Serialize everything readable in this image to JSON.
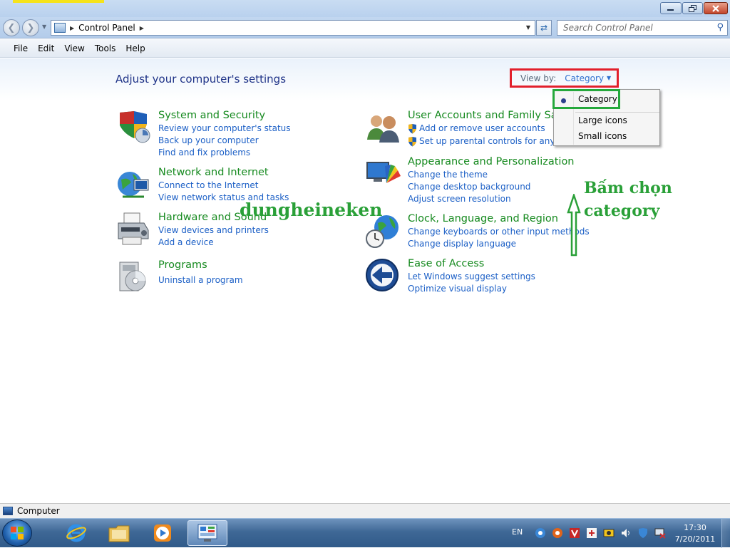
{
  "window": {
    "minimize_icon": "minimize-icon",
    "maximize_icon": "restore-icon",
    "close_icon": "close-icon"
  },
  "address_bar": {
    "breadcrumb": [
      "Control Panel"
    ],
    "search_placeholder": "Search Control Panel"
  },
  "menu": [
    "File",
    "Edit",
    "View",
    "Tools",
    "Help"
  ],
  "main": {
    "heading": "Adjust your computer's settings",
    "view_by_label": "View by:",
    "view_by_value": "Category",
    "view_options": [
      "Category",
      "Large icons",
      "Small icons"
    ],
    "selected_option": "Category"
  },
  "categories": [
    {
      "title": "System and Security",
      "icon": "shield-icon",
      "links": [
        "Review your computer's status",
        "Back up your computer",
        "Find and fix problems"
      ]
    },
    {
      "title": "Network and Internet",
      "icon": "network-globe-icon",
      "links": [
        "Connect to the Internet",
        "View network status and tasks"
      ]
    },
    {
      "title": "Hardware and Sound",
      "icon": "printer-icon",
      "links": [
        "View devices and printers",
        "Add a device"
      ]
    },
    {
      "title": "Programs",
      "icon": "programs-disc-icon",
      "links": [
        "Uninstall a program"
      ]
    },
    {
      "title": "User Accounts and Family Safety",
      "icon": "users-icon",
      "links": [
        "Add or remove user accounts",
        "Set up parental controls for any user"
      ]
    },
    {
      "title": "Appearance and Personalization",
      "icon": "monitor-palette-icon",
      "links": [
        "Change the theme",
        "Change desktop background",
        "Adjust screen resolution"
      ]
    },
    {
      "title": "Clock, Language, and Region",
      "icon": "clock-globe-icon",
      "links": [
        "Change keyboards or other input methods",
        "Change display language"
      ]
    },
    {
      "title": "Ease of Access",
      "icon": "ease-of-access-icon",
      "links": [
        "Let Windows suggest settings",
        "Optimize visual display"
      ]
    }
  ],
  "annotations": {
    "watermark": "dungheineken",
    "instruction_line1": "Bấm chọn",
    "instruction_line2": "category",
    "highlight_red": "#e2202c",
    "highlight_green": "#25a83c"
  },
  "status_bar": {
    "text": "Computer"
  },
  "taskbar": {
    "pinned": [
      "internet-explorer-icon",
      "windows-explorer-icon",
      "media-player-icon",
      "control-panel-icon"
    ],
    "language": "EN",
    "time": "17:30",
    "date": "7/20/2011"
  }
}
